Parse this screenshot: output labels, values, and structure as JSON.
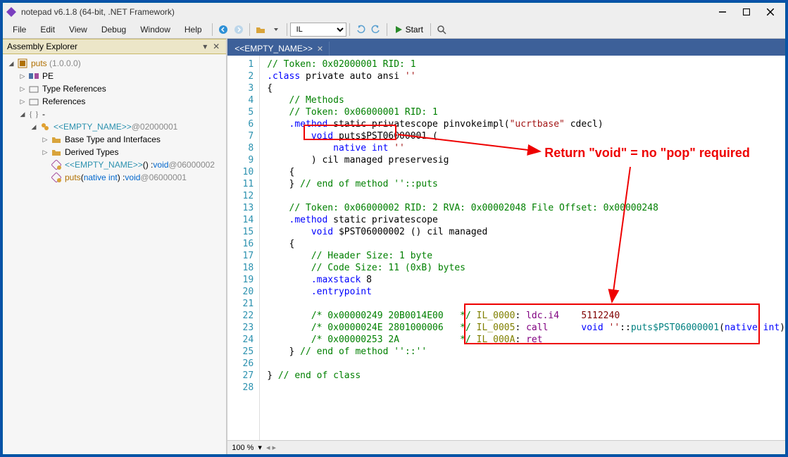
{
  "window": {
    "title": "notepad v6.1.8 (64-bit, .NET Framework)"
  },
  "menubar": [
    "File",
    "Edit",
    "View",
    "Debug",
    "Window",
    "Help"
  ],
  "toolbar": {
    "format_select": "IL",
    "start_label": "Start"
  },
  "panel": {
    "title": "Assembly Explorer"
  },
  "tree": {
    "root": {
      "name": "puts",
      "ver": "(1.0.0.0)"
    },
    "nodes": {
      "pe": "PE",
      "type_refs": "Type References",
      "refs": "References",
      "dash": "-",
      "empty_cls": "<<EMPTY_NAME>>",
      "empty_cls_addr": " @02000001",
      "base_types": "Base Type and Interfaces",
      "derived": "Derived Types",
      "m1_name": "<<EMPTY_NAME>>",
      "m1_sig": "() : ",
      "m1_ret": "void",
      "m1_addr": " @06000002",
      "m2_name": "puts",
      "m2_arg_l": "(",
      "m2_arg_t": "native int",
      "m2_arg_r": ") : ",
      "m2_ret": "void",
      "m2_addr": " @06000001"
    }
  },
  "tab": {
    "title": "<<EMPTY_NAME>>"
  },
  "annotation": {
    "text": "Return \"void\" = no \"pop\" required"
  },
  "zoom": "100 %",
  "code": {
    "l1": {
      "a": "// Token: 0x02000001 RID: 1"
    },
    "l2": {
      "a": ".class",
      "b": " private auto ansi ",
      "c": "''"
    },
    "l3": {
      "a": "{"
    },
    "l4": {
      "a": "    ",
      "b": "// Methods"
    },
    "l5": {
      "a": "    ",
      "b": "// Token: 0x06000001 RID: 1"
    },
    "l6": {
      "a": "    ",
      "b": ".method",
      "c": " static privatescope pinvokeimpl",
      "d": "(",
      "e": "\"ucrtbase\"",
      "f": " cdecl",
      "g": ")"
    },
    "l7": {
      "a": "        ",
      "b": "void",
      "c": " puts$PST06000001 ",
      "d": "("
    },
    "l8": {
      "a": "            ",
      "b": "native int",
      "c": " ",
      "d": "''"
    },
    "l9": {
      "a": "        ",
      "b": ")",
      "c": " cil managed preservesig"
    },
    "l10": {
      "a": "    ",
      "b": "{"
    },
    "l11": {
      "a": "    ",
      "b": "}",
      "c": " ",
      "d": "// end of method ''::puts"
    },
    "l12": {
      "a": ""
    },
    "l13": {
      "a": "    ",
      "b": "// Token: 0x06000002 RID: 2 RVA: 0x00002048 File Offset: 0x00000248"
    },
    "l14": {
      "a": "    ",
      "b": ".method",
      "c": " static privatescope"
    },
    "l15": {
      "a": "        ",
      "b": "void",
      "c": " $PST06000002 ",
      "d": "()",
      "e": " cil managed"
    },
    "l16": {
      "a": "    ",
      "b": "{"
    },
    "l17": {
      "a": "        ",
      "b": "// Header Size: 1 byte"
    },
    "l18": {
      "a": "        ",
      "b": "// Code Size: 11 (0xB) bytes"
    },
    "l19": {
      "a": "        ",
      "b": ".maxstack",
      "c": " 8"
    },
    "l20": {
      "a": "        ",
      "b": ".entrypoint"
    },
    "l21": {
      "a": ""
    },
    "l22": {
      "a": "        ",
      "b": "/* 0x00000249 20B0014E00   */",
      "c": " ",
      "d": "IL_0000",
      "e": ": ",
      "f": "ldc.i4",
      "g": "    ",
      "h": "5112240"
    },
    "l23": {
      "a": "        ",
      "b": "/* 0x0000024E 2801000006   */",
      "c": " ",
      "d": "IL_0005",
      "e": ": ",
      "f": "call",
      "g": "      ",
      "h": "void",
      "i": " ",
      "j": "''",
      "k": "::",
      "l": "puts$PST06000001",
      "m": "(",
      "n": "native int",
      "o": ")"
    },
    "l24": {
      "a": "        ",
      "b": "/* 0x00000253 2A           */",
      "c": " ",
      "d": "IL_000A",
      "e": ": ",
      "f": "ret"
    },
    "l25": {
      "a": "    ",
      "b": "}",
      "c": " ",
      "d": "// end of method ''::''"
    },
    "l26": {
      "a": ""
    },
    "l27": {
      "a": "}",
      "b": " ",
      "c": "// end of class"
    },
    "l28": {
      "a": ""
    }
  }
}
